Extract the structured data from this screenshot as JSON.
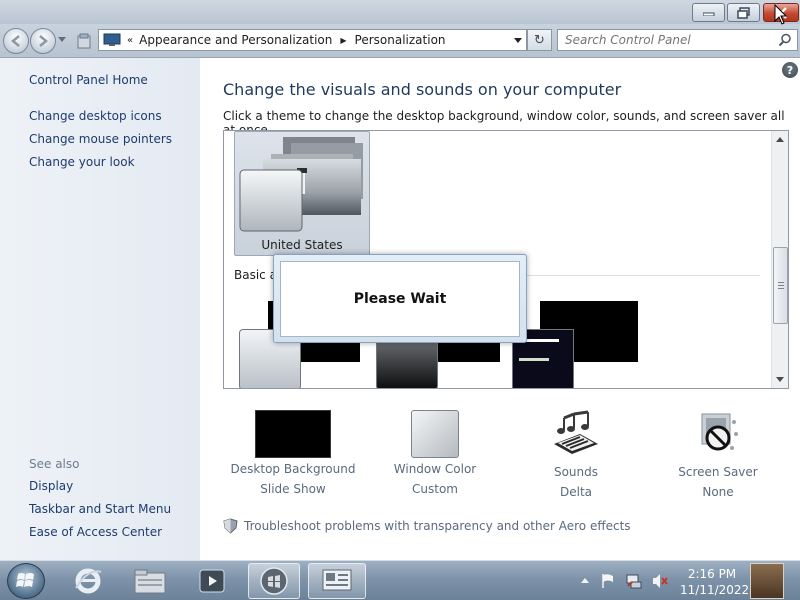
{
  "window": {
    "controls": {
      "minimize": "minimize",
      "maximize": "restore",
      "close": "close"
    }
  },
  "navbar": {
    "breadcrumb_chevron": "«",
    "breadcrumb": [
      "Appearance and Personalization",
      "Personalization"
    ],
    "breadcrumb_separator": "▶",
    "refresh_glyph": "↻",
    "search_placeholder": "Search Control Panel"
  },
  "left_pane": {
    "home": "Control Panel Home",
    "links": [
      "Change desktop icons",
      "Change mouse pointers",
      "Change your look"
    ],
    "see_also_label": "See also",
    "see_also": [
      "Display",
      "Taskbar and Start Menu",
      "Ease of Access Center"
    ]
  },
  "main": {
    "help": "?",
    "heading": "Change the visuals and sounds on your computer",
    "subtext": "Click a theme to change the desktop background, window color, sounds, and screen saver all at once.",
    "theme_selected": "United States",
    "basic_section_label": "Basic ar"
  },
  "dialog": {
    "message": "Please Wait"
  },
  "options": [
    {
      "title": "Desktop Background",
      "value": "Slide Show"
    },
    {
      "title": "Window Color",
      "value": "Custom"
    },
    {
      "title": "Sounds",
      "value": "Delta"
    },
    {
      "title": "Screen Saver",
      "value": "None"
    }
  ],
  "troubleshoot": "Troubleshoot problems with transparency and other Aero effects",
  "taskbar": {
    "time": "2:16 PM",
    "date": "11/11/2022",
    "pinned": [
      "internet-explorer",
      "windows-explorer",
      "media-player",
      "personalization-window",
      "control-panel"
    ]
  },
  "colors": {
    "link": "#1e3c6e",
    "heading": "#1f3a5c",
    "option_text": "#5a6b7d",
    "close_button": "#c44a32"
  }
}
